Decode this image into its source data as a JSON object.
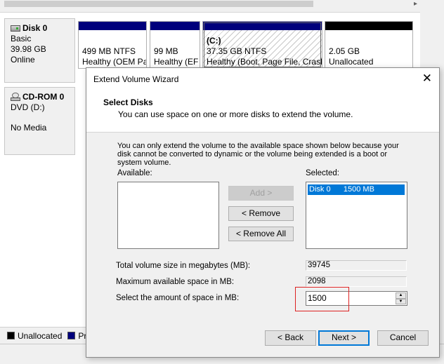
{
  "background": {
    "disks": [
      {
        "name": "Disk 0",
        "type": "Basic",
        "size": "39.98 GB",
        "status": "Online"
      },
      {
        "name": "CD-ROM 0",
        "type": "DVD (D:)",
        "status": "No Media"
      }
    ],
    "partitions": [
      {
        "size": "499 MB NTFS",
        "status": "Healthy (OEM Pa"
      },
      {
        "size": "99 MB",
        "status": "Healthy (EF"
      },
      {
        "label": "(C:)",
        "size": "37.35 GB NTFS",
        "status": "Healthy (Boot, Page File, Crash"
      },
      {
        "size": "2.05 GB",
        "status": "Unallocated"
      }
    ],
    "legend": {
      "unallocated": "Unallocated",
      "primary": "Pri"
    }
  },
  "dialog": {
    "title": "Extend Volume Wizard",
    "header_title": "Select Disks",
    "header_subtitle": "You can use space on one or more disks to extend the volume.",
    "note": "You can only extend the volume to the available space shown below because your disk cannot be converted to dynamic or the volume being extended is a boot or system volume.",
    "available_label": "Available:",
    "selected_label": "Selected:",
    "selected_items": [
      "Disk 0      1500 MB"
    ],
    "add_button": "Add >",
    "remove_button": "< Remove",
    "remove_all_button": "< Remove All",
    "total_label": "Total volume size in megabytes (MB):",
    "total_value": "39745",
    "max_label": "Maximum available space in MB:",
    "max_value": "2098",
    "amount_label": "Select the amount of space in MB:",
    "amount_value": "1500",
    "back_button": "< Back",
    "next_button": "Next >",
    "cancel_button": "Cancel"
  },
  "colors": {
    "partition_bar": "#00007c",
    "selection": "#0078d7",
    "highlight_box": "#dd2222"
  }
}
